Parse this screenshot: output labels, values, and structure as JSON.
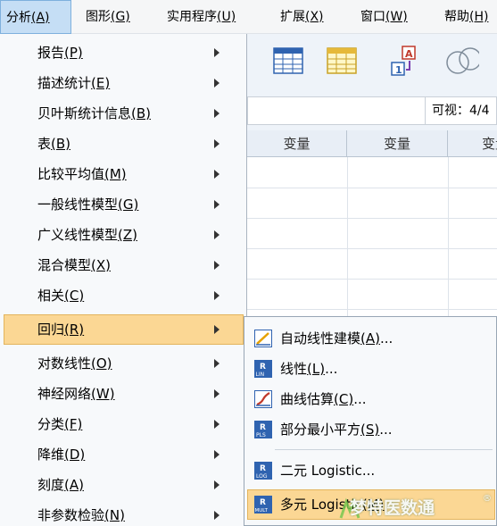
{
  "menubar": {
    "items": [
      {
        "label": "分析",
        "key": "(A)",
        "active": true
      },
      {
        "label": "图形",
        "key": "(G)"
      },
      {
        "label": "实用程序",
        "key": "(U)"
      },
      {
        "label": "扩展",
        "key": "(X)"
      },
      {
        "label": "窗口",
        "key": "(W)"
      },
      {
        "label": "帮助",
        "key": "(H)"
      }
    ]
  },
  "analyze_menu": {
    "items": [
      {
        "label": "报告",
        "key": "(P)"
      },
      {
        "label": "描述统计",
        "key": "(E)"
      },
      {
        "label": "贝叶斯统计信息",
        "key": "(B)"
      },
      {
        "label": "表",
        "key": "(B)"
      },
      {
        "label": "比较平均值",
        "key": "(M)"
      },
      {
        "label": "一般线性模型",
        "key": "(G)"
      },
      {
        "label": "广义线性模型",
        "key": "(Z)"
      },
      {
        "label": "混合模型",
        "key": "(X)"
      },
      {
        "label": "相关",
        "key": "(C)"
      },
      {
        "label": "回归",
        "key": "(R)",
        "highlighted": true
      },
      {
        "label": "对数线性",
        "key": "(O)"
      },
      {
        "label": "神经网络",
        "key": "(W)"
      },
      {
        "label": "分类",
        "key": "(F)"
      },
      {
        "label": "降维",
        "key": "(D)"
      },
      {
        "label": "刻度",
        "key": "(A)"
      },
      {
        "label": "非参数检验",
        "key": "(N)"
      }
    ]
  },
  "regression_submenu": {
    "items": [
      {
        "label": "自动线性建模",
        "key": "(A)",
        "suffix": "...",
        "icon": "auto-linear-icon",
        "icon_text": ""
      },
      {
        "label": "线性",
        "key": "(L)",
        "suffix": "...",
        "icon": "linear-icon",
        "icon_text": "LIN"
      },
      {
        "label": "曲线估算",
        "key": "(C)",
        "suffix": "...",
        "icon": "curve-estimation-icon",
        "icon_text": ""
      },
      {
        "label": "部分最小平方",
        "key": "(S)",
        "suffix": "...",
        "icon": "pls-icon",
        "icon_text": "PLS"
      },
      {
        "label": "二元 Logistic...",
        "key": "",
        "suffix": "",
        "icon": "binary-logistic-icon",
        "icon_text": "LOG"
      },
      {
        "label": "多元 Logistic",
        "key": "(M)",
        "suffix": "",
        "icon": "multinomial-logistic-icon",
        "icon_text": "MULT",
        "highlighted": true
      }
    ]
  },
  "data_editor": {
    "visible_label": "可视：4/4",
    "column_header": "变量"
  },
  "watermark": {
    "text": "梦特医数通",
    "reg": "®"
  },
  "colors": {
    "menu_highlight": "#fbd794",
    "menubar_active": "#c5def5",
    "icon_blue": "#2f63b0"
  }
}
